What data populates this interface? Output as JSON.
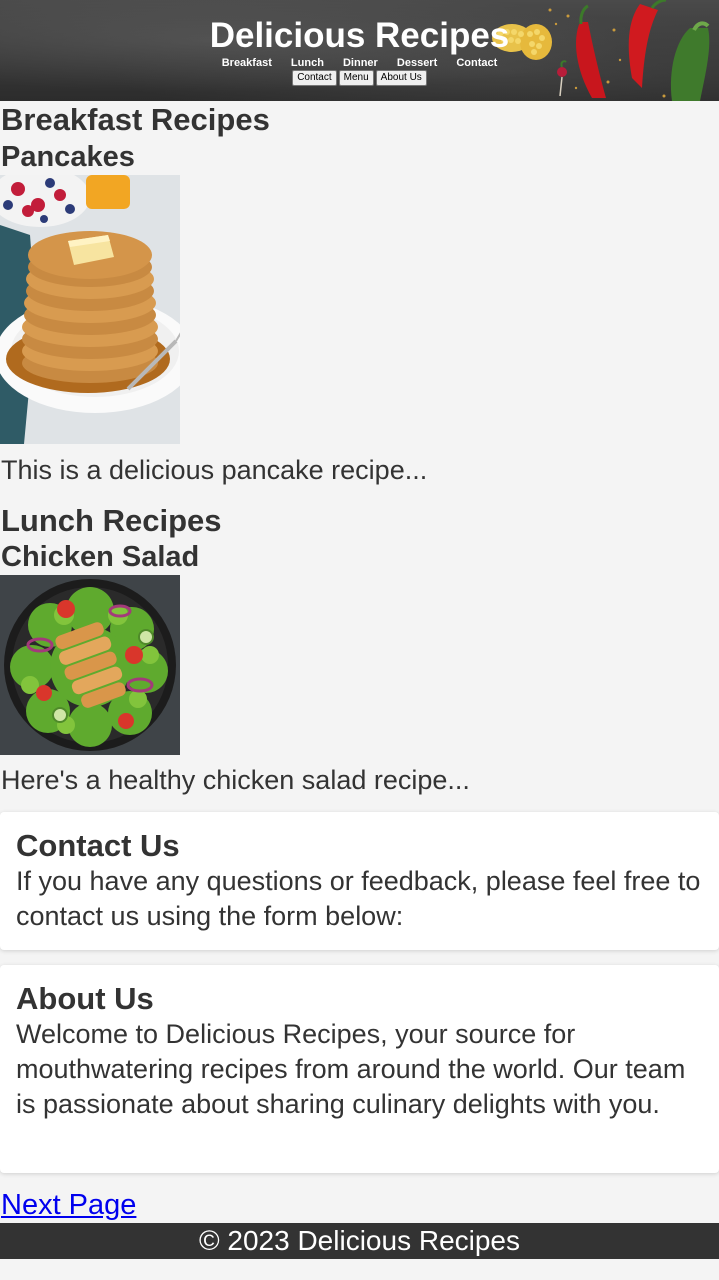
{
  "header": {
    "title": "Delicious Recipes",
    "nav": [
      "Breakfast",
      "Lunch",
      "Dinner",
      "Dessert",
      "Contact"
    ],
    "buttons": [
      "Contact",
      "Menu",
      "About Us"
    ]
  },
  "breakfast": {
    "heading": "Breakfast Recipes",
    "dish_title": "Pancakes",
    "dish_text": "This is a delicious pancake recipe..."
  },
  "lunch": {
    "heading": "Lunch Recipes",
    "dish_title": "Chicken Salad",
    "dish_text": "Here's a healthy chicken salad recipe..."
  },
  "contact": {
    "heading": "Contact Us",
    "text": "If you have any questions or feedback, please feel free to contact us using the form below:"
  },
  "about": {
    "heading": "About Us",
    "text": "Welcome to Delicious Recipes, your source for mouthwatering recipes from around the world. Our team is passionate about sharing culinary delights with you."
  },
  "next_link": "Next Page",
  "footer": "© 2023 Delicious Recipes"
}
